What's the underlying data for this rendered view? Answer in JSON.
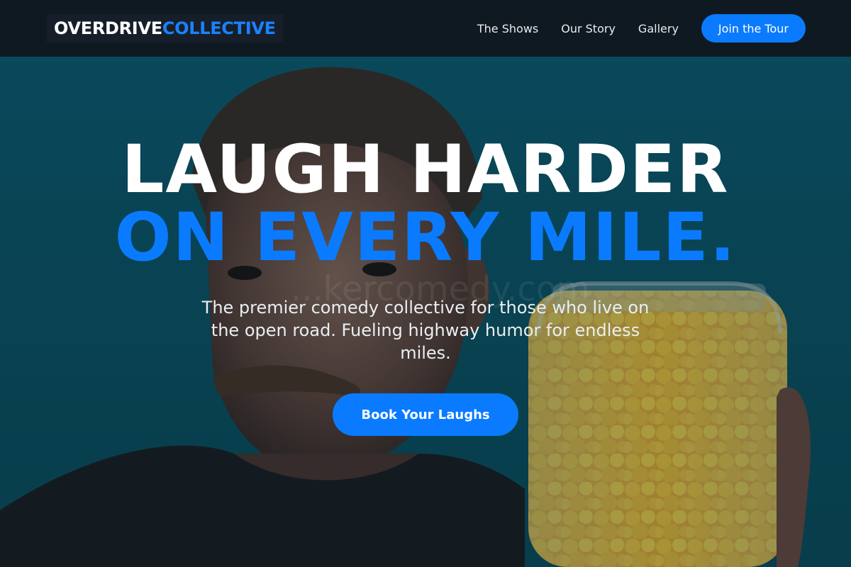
{
  "brand": {
    "part1": "OVERDRIVE",
    "part2": "COLLECTIVE"
  },
  "nav": {
    "links": [
      {
        "label": "The Shows"
      },
      {
        "label": "Our Story"
      },
      {
        "label": "Gallery"
      }
    ],
    "cta_label": "Join the Tour"
  },
  "hero": {
    "headline_line1": "LAUGH HARDER",
    "headline_line2": "ON EVERY MILE.",
    "subtitle": "The premier comedy collective for those who live on the open road. Fueling highway humor for endless miles.",
    "cta_label": "Book Your Laughs",
    "watermark": "...kercomedy.com",
    "photo_alt": "Mustached man in black t-shirt holding a jar of yellow cheese puffs against a teal background"
  },
  "colors": {
    "accent": "#0a7bff",
    "nav_bg": "#0f1922",
    "hero_bg": "#0b5466"
  }
}
